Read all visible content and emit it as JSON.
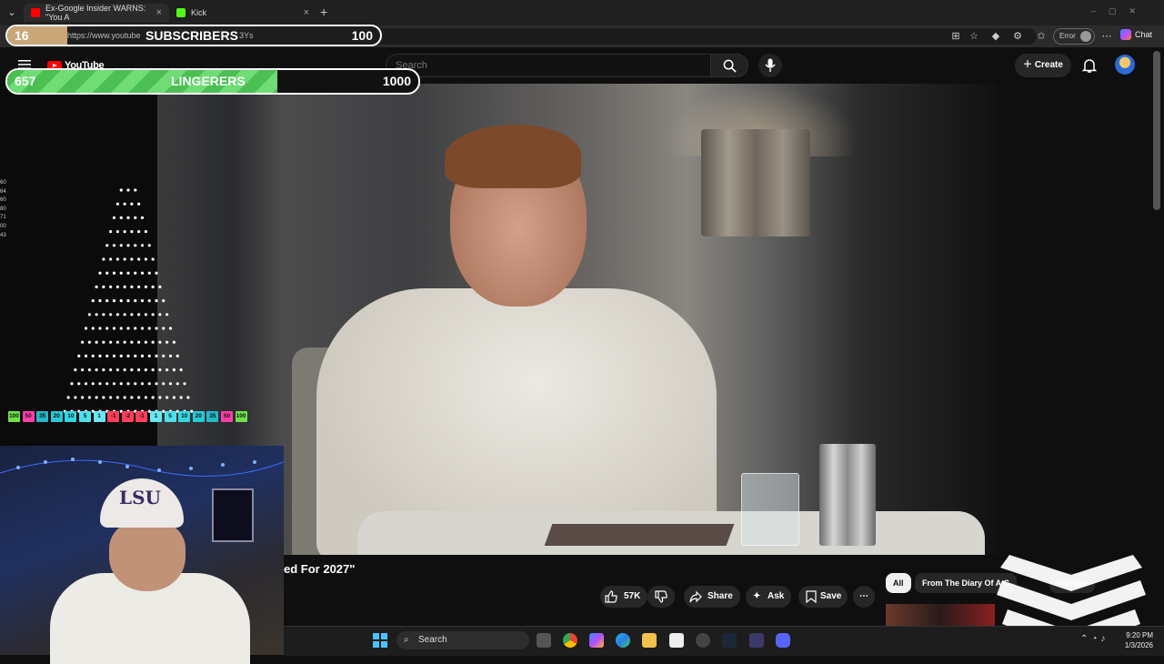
{
  "browser": {
    "tabs": [
      {
        "title": "Ex-Google Insider WARNS: \"You A",
        "favicon_color": "#ff0000"
      },
      {
        "title": "Kick",
        "favicon_color": "#53fc18"
      }
    ],
    "new_tab_symbol": "+",
    "url": "https://www.youtube",
    "url_tail": "3Ys",
    "profile_status": "Error",
    "copilot_label": "Chat"
  },
  "youtube": {
    "logo_text": "YouTube",
    "search_placeholder": "Search",
    "create_label": "Create",
    "video_title_fragment": "ed For 2027\"",
    "like_count": "57K",
    "share_label": "Share",
    "ask_label": "Ask",
    "save_label": "Save",
    "chips": [
      "All",
      "From The Diary Of A C",
      "Intellige"
    ],
    "more_symbol": "⋯"
  },
  "overlays": {
    "subscribers": {
      "current": "16",
      "label": "SUBSCRIBERS",
      "goal": "100",
      "progress": 0.16
    },
    "lingerers": {
      "current": "657",
      "label": "LINGERERS",
      "goal": "1000",
      "progress": 0.657
    }
  },
  "plinko": {
    "side_ticks": [
      "60",
      "64",
      "60",
      "80",
      "71",
      "00",
      "43"
    ],
    "slots": [
      {
        "v": "100",
        "c": "#6ee14b"
      },
      {
        "v": "50",
        "c": "#ff3fa8"
      },
      {
        "v": "35",
        "c": "#25b8c7"
      },
      {
        "v": "20",
        "c": "#28c9d8"
      },
      {
        "v": "10",
        "c": "#35d6e4"
      },
      {
        "v": "5",
        "c": "#4fe0ee"
      },
      {
        "v": "1",
        "c": "#6ae7f2"
      },
      {
        "v": "-1",
        "c": "#ff3f5c"
      },
      {
        "v": "-2",
        "c": "#ff3f5c"
      },
      {
        "v": "-1",
        "c": "#ff3f5c"
      },
      {
        "v": "1",
        "c": "#6ae7f2"
      },
      {
        "v": "5",
        "c": "#4fe0ee"
      },
      {
        "v": "10",
        "c": "#35d6e4"
      },
      {
        "v": "20",
        "c": "#28c9d8"
      },
      {
        "v": "35",
        "c": "#25b8c7"
      },
      {
        "v": "50",
        "c": "#ff3fa8"
      },
      {
        "v": "100",
        "c": "#6ee14b"
      }
    ]
  },
  "webcam": {
    "cap_text": "LSU"
  },
  "taskbar": {
    "search_label": "Search",
    "time": "9:20 PM",
    "date": "1/3/2026"
  }
}
